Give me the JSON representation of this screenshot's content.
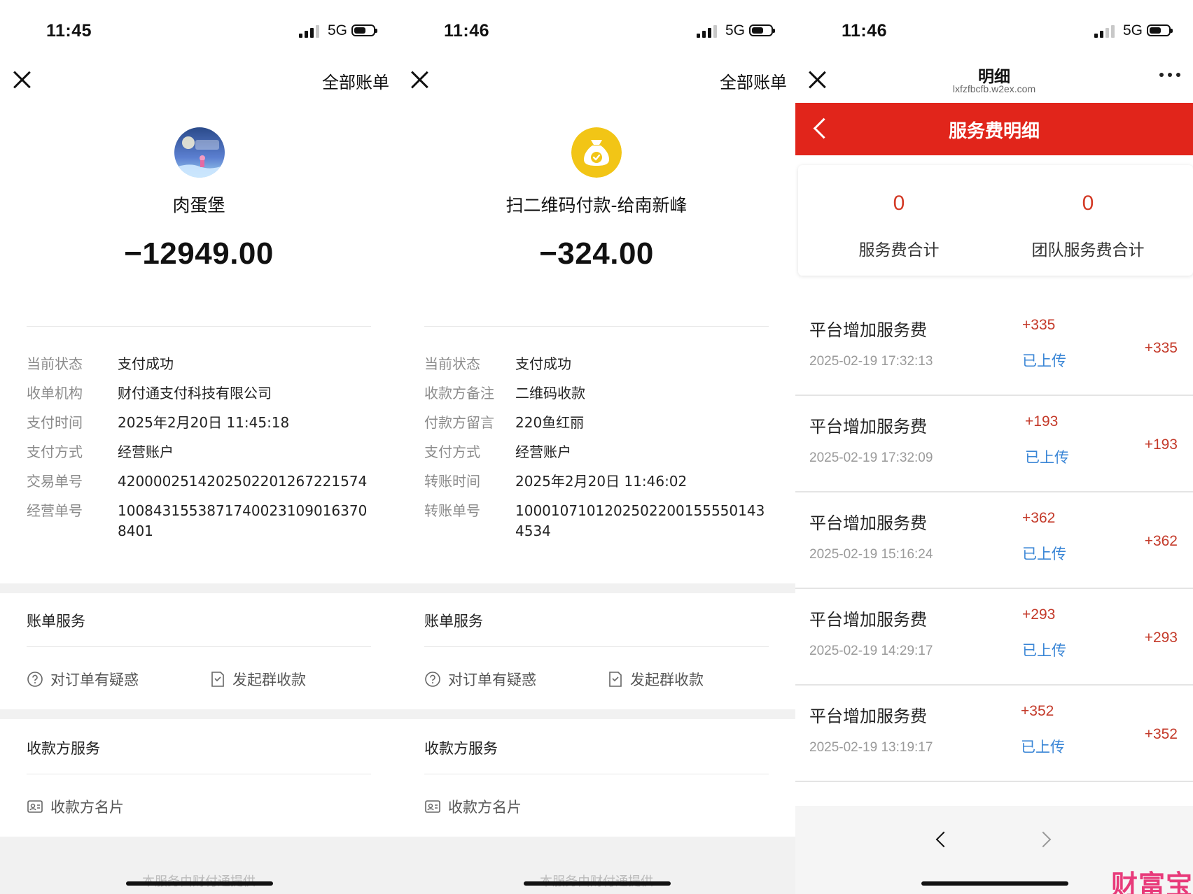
{
  "left": {
    "status": {
      "time": "11:45",
      "network": "5G"
    },
    "all_bills": "全部账单",
    "merchant": "肉蛋堡",
    "amount": "−12949.00",
    "details": [
      {
        "label": "当前状态",
        "value": "支付成功"
      },
      {
        "label": "收单机构",
        "value": "财付通支付科技有限公司"
      },
      {
        "label": "支付时间",
        "value": "2025年2月20日 11:45:18"
      },
      {
        "label": "支付方式",
        "value": "经营账户"
      },
      {
        "label": "交易单号",
        "value": "4200002514202502201267221574"
      },
      {
        "label": "经营单号",
        "value": "1008431553871740023109016370 8401"
      }
    ],
    "bill_service_title": "账单服务",
    "order_question": "对订单有疑惑",
    "group_collect": "发起群收款",
    "payee_service_title": "收款方服务",
    "payee_card": "收款方名片",
    "footer_text": "本服务由财付通提供"
  },
  "middle": {
    "status": {
      "time": "11:46",
      "network": "5G"
    },
    "all_bills": "全部账单",
    "merchant": "扫二维码付款-给南新峰",
    "amount": "−324.00",
    "details": [
      {
        "label": "当前状态",
        "value": "支付成功"
      },
      {
        "label": "收款方备注",
        "value": "二维码收款"
      },
      {
        "label": "付款方留言",
        "value": "220鱼红丽"
      },
      {
        "label": "支付方式",
        "value": "经营账户"
      },
      {
        "label": "转账时间",
        "value": "2025年2月20日 11:46:02"
      },
      {
        "label": "转账单号",
        "value": "1000107101202502200155550143 4534"
      }
    ],
    "bill_service_title": "账单服务",
    "order_question": "对订单有疑惑",
    "group_collect": "发起群收款",
    "payee_service_title": "收款方服务",
    "payee_card": "收款方名片",
    "footer_text": "本服务由财付通提供"
  },
  "right": {
    "status": {
      "time": "11:46",
      "network": "5G"
    },
    "page_title": "明细",
    "url": "lxfzfbcfb.w2ex.com",
    "header_title": "服务费明细",
    "summary": {
      "service_fee_total_value": "0",
      "service_fee_total_label": "服务费合计",
      "team_fee_total_value": "0",
      "team_fee_total_label": "团队服务费合计"
    },
    "items": [
      {
        "name": "平台增加服务费",
        "time": "2025-02-19 17:32:13",
        "amount": "+335",
        "status": "已上传"
      },
      {
        "name": "平台增加服务费",
        "time": "2025-02-19 17:32:09",
        "amount": "+193",
        "status": "已上传"
      },
      {
        "name": "平台增加服务费",
        "time": "2025-02-19 15:16:24",
        "amount": "+362",
        "status": "已上传"
      },
      {
        "name": "平台增加服务费",
        "time": "2025-02-19 14:29:17",
        "amount": "+293",
        "status": "已上传"
      },
      {
        "name": "平台增加服务费",
        "time": "2025-02-19 13:19:17",
        "amount": "+352",
        "status": "已上传"
      }
    ],
    "watermark": "财富宝",
    "colors": {
      "header_red": "#e1251b",
      "amount_red": "#c43a2a",
      "status_blue": "#3a86d6"
    }
  }
}
